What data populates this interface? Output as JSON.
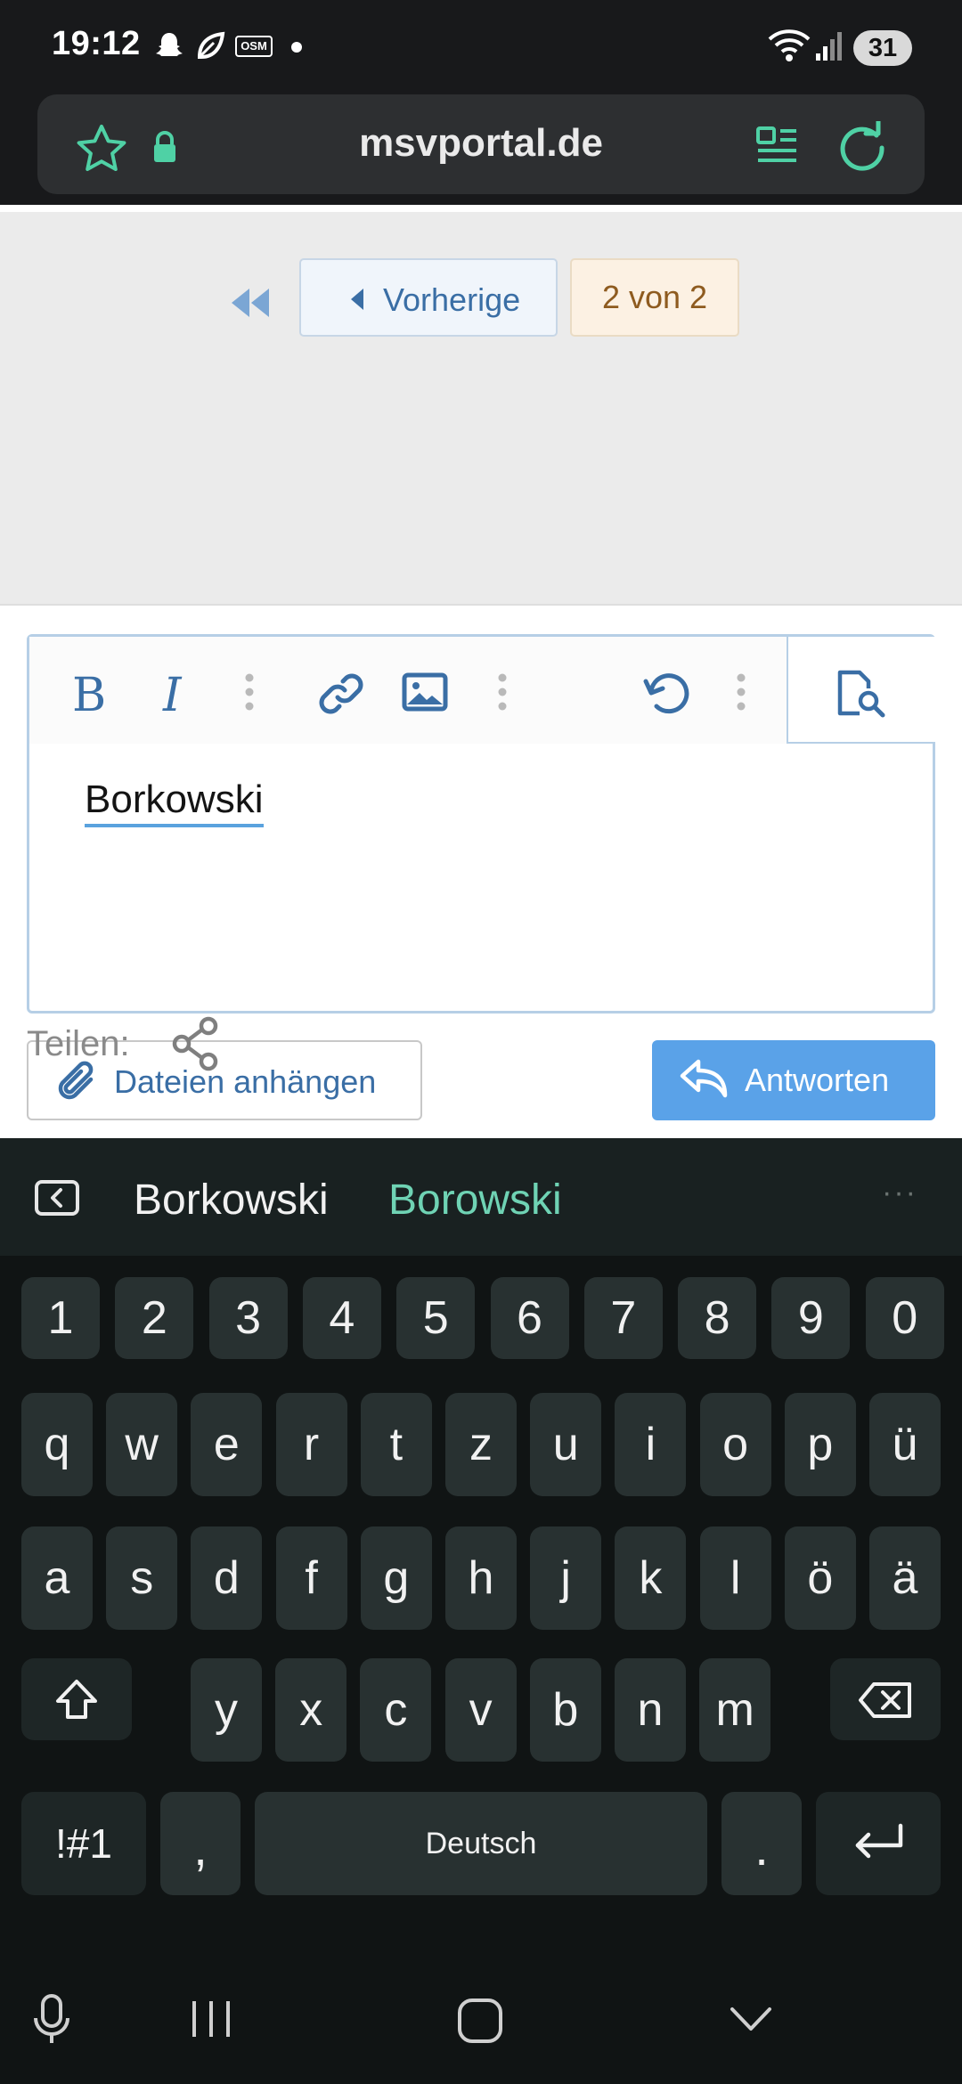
{
  "status_bar": {
    "time": "19:12",
    "notification_icons": [
      "snapchat-icon",
      "leaf-icon",
      "osm-icon",
      "dot-icon"
    ],
    "osm_label": "OSM",
    "battery": "31"
  },
  "browser": {
    "url": "msvportal.de"
  },
  "pagination": {
    "prev_label": "Vorherige",
    "page_indicator": "2 von 2"
  },
  "editor": {
    "text": "Borkowski"
  },
  "actions": {
    "attach_label": "Dateien anhängen",
    "reply_label": "Antworten"
  },
  "share": {
    "label": "Teilen:"
  },
  "keyboard": {
    "suggestions": [
      "Borkowski",
      "Borowski"
    ],
    "more": "···",
    "row_numbers": [
      "1",
      "2",
      "3",
      "4",
      "5",
      "6",
      "7",
      "8",
      "9",
      "0"
    ],
    "row1": [
      "q",
      "w",
      "e",
      "r",
      "t",
      "z",
      "u",
      "i",
      "o",
      "p",
      "ü"
    ],
    "row2": [
      "a",
      "s",
      "d",
      "f",
      "g",
      "h",
      "j",
      "k",
      "l",
      "ö",
      "ä"
    ],
    "row3": [
      "y",
      "x",
      "c",
      "v",
      "b",
      "n",
      "m"
    ],
    "symbols": "!#1",
    "comma": ",",
    "space": "Deutsch",
    "period": "."
  },
  "colors": {
    "accent_blue": "#3a6ea5",
    "reply_button": "#5aa2e8",
    "suggestion_highlight": "#6fd3b4",
    "browser_icons": "#4fd1a5"
  }
}
